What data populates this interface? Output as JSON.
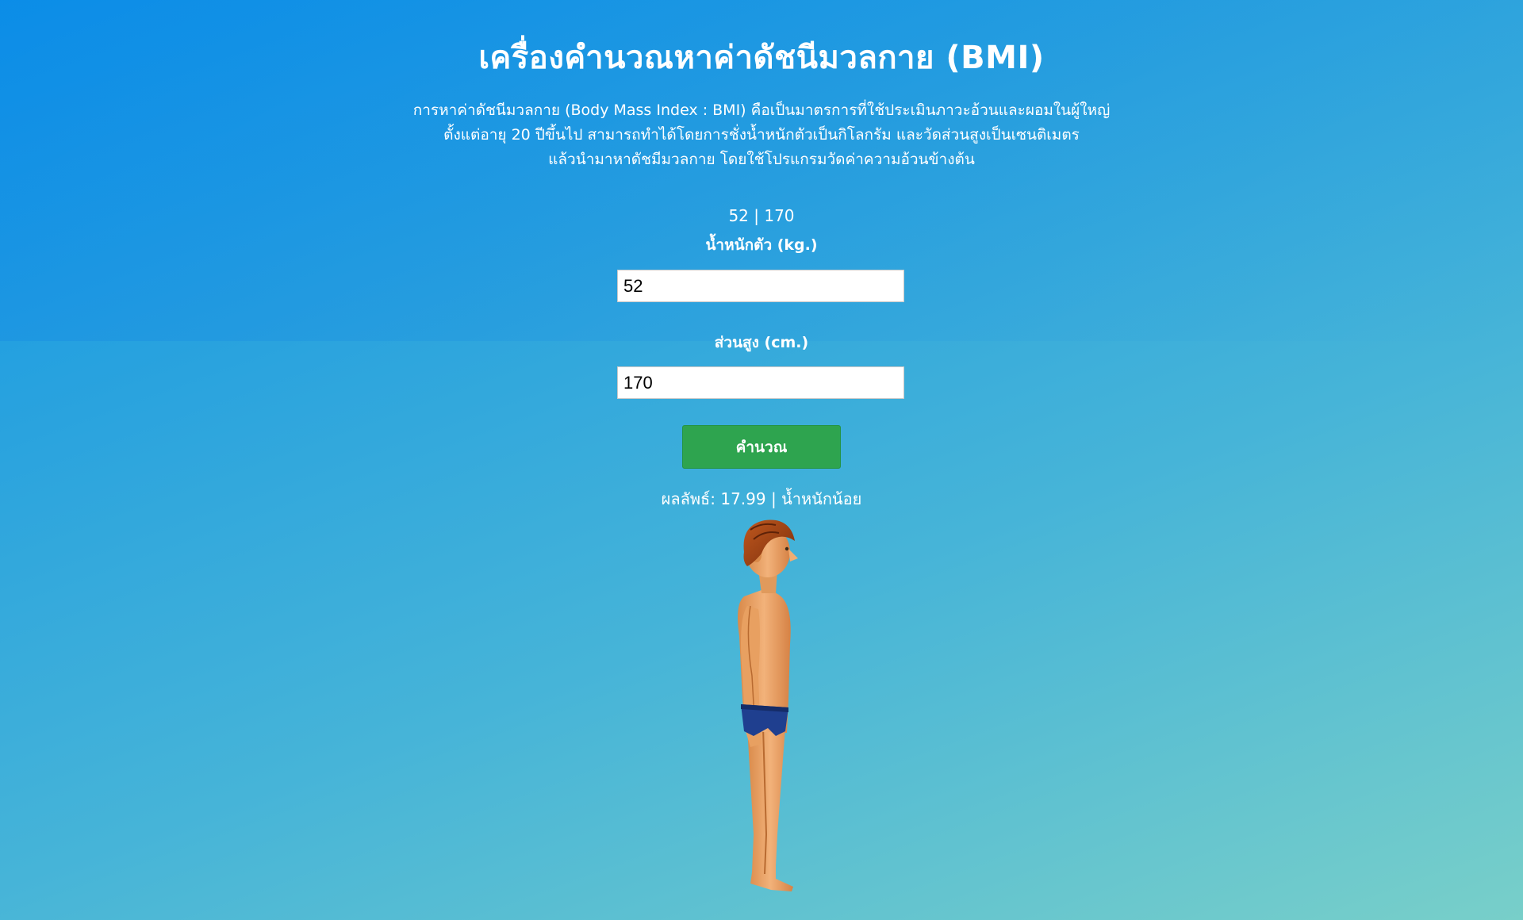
{
  "title": "เครื่องคำนวณหาค่าดัชนีมวลกาย (BMI)",
  "description": {
    "line1": "การหาค่าดัชนีมวลกาย (Body Mass Index : BMI) คือเป็นมาตรการที่ใช้ประเมินภาวะอ้วนและผอมในผู้ใหญ่",
    "line2": "ตั้งแต่อายุ 20 ปีขึ้นไป สามารถทำได้โดยการชั่งน้ำหนักตัวเป็นกิโลกรัม และวัดส่วนสูงเป็นเซนติเมตร",
    "line3": "แล้วนำมาหาดัชมีมวลกาย โดยใช้โปรแกรมวัดค่าความอ้วนข้างต้น"
  },
  "readout": "52 | 170",
  "weight": {
    "label": "น้ำหนักตัว (kg.)",
    "value": "52"
  },
  "height": {
    "label": "ส่วนสูง (cm.)",
    "value": "170"
  },
  "calculate_label": "คำนวณ",
  "result": "ผลลัพธ์: 17.99 | น้ำหนักน้อย",
  "figure_icon": "standing-person-side-view",
  "colors": {
    "button": "#2ea44f",
    "background_top": "#0f97e8",
    "background_bottom": "#78cfc9"
  }
}
